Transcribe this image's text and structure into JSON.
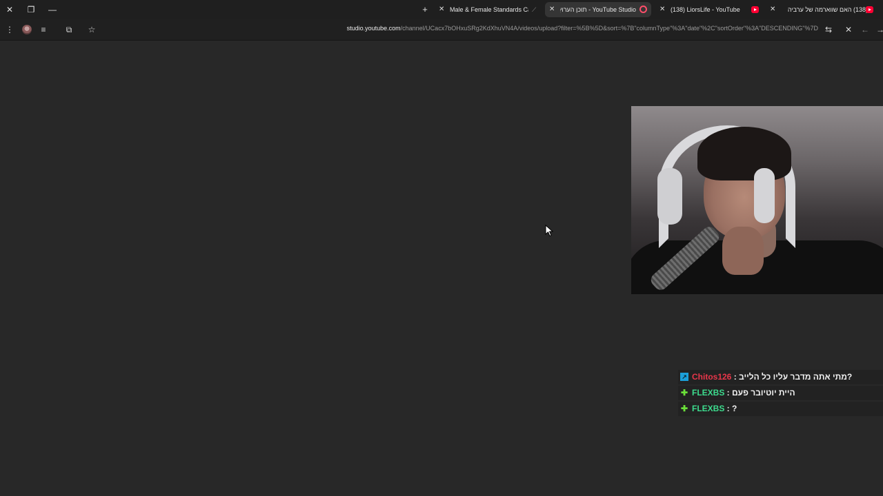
{
  "tabs": [
    {
      "title": "Male & Female Standards Calcu",
      "active": false,
      "favicon": "chart-favicon"
    },
    {
      "title": "YouTube Studio - תוכן הערוץ",
      "active": true,
      "favicon": "studio-favicon"
    },
    {
      "title": "(138) LiorsLife - YouTube",
      "active": false,
      "favicon": "youtube-favicon"
    },
    {
      "title": "(138) האם שווארמה של ערביה",
      "active": false,
      "favicon": "youtube-favicon"
    }
  ],
  "address_bar": {
    "host": "studio.youtube.com",
    "path": "/channel/UCacx7bOHxuSRg2KdXhuVN4A/videos/upload?filter=%5B%5D&sort=%7B\"columnType\"%3A\"date\"%2C\"sortOrder\"%3A\"DESCENDING\"%7D"
  },
  "chat": [
    {
      "user": "Chitos126",
      "user_color": "#e8364a",
      "message": "?מתי אתה מדבר עליו כל הלייב",
      "badge": "box-badge-icon"
    },
    {
      "user": "FLEXBS",
      "user_color": "#3ddc8e",
      "message": "היית יוטיובר פעם",
      "badge": "plus-badge-icon"
    },
    {
      "user": "FLEXBS",
      "user_color": "#3ddc8e",
      "message": "?",
      "badge": "plus-badge-icon"
    }
  ],
  "colors": {
    "page_bg": "#282828",
    "tabstrip_bg": "#1f1f1f",
    "active_tab_bg": "#353535"
  }
}
